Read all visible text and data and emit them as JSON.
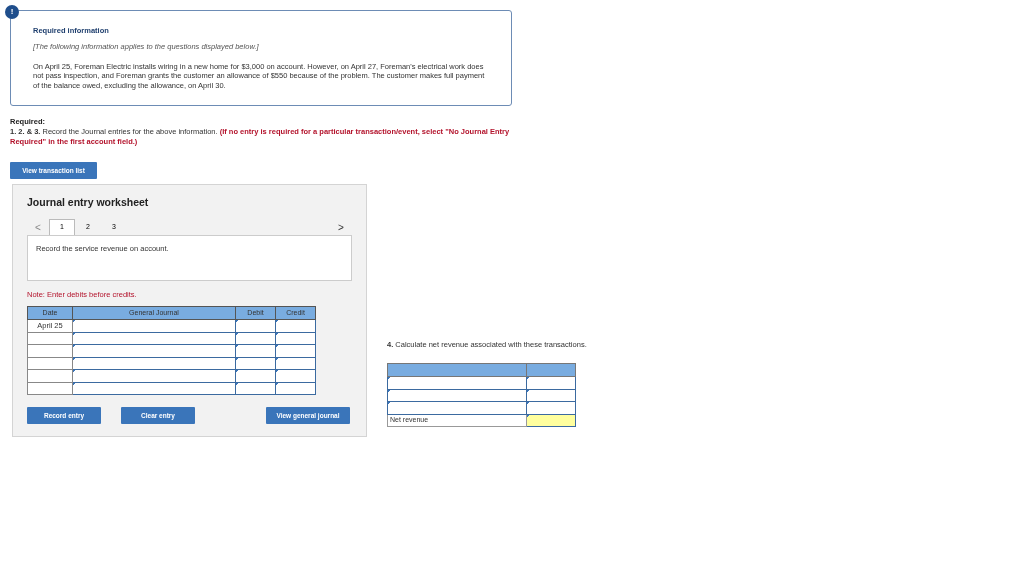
{
  "info": {
    "badge": "!",
    "title": "Required information",
    "intro": "[The following information applies to the questions displayed below.]",
    "body": "On April 25, Foreman Electric installs wiring in a new home for $3,000 on account. However, on April 27, Foreman's electrical work does not pass inspection, and Foreman grants the customer an allowance of $550 because of the problem. The customer makes full payment of the balance owed, excluding the allowance, on April 30."
  },
  "required": {
    "label": "Required:",
    "instruction": "**1. 2. & 3.** Record the Journal entries for the above information.",
    "note": "(If no entry is required for a particular transaction/event, select \"No Journal Entry Required\" in the first account field.)"
  },
  "transaction_button": "View transaction list",
  "worksheet": {
    "title": "Journal entry worksheet",
    "prev": "<",
    "next": ">",
    "tabs": [
      {
        "label": "1",
        "selected": true
      },
      {
        "label": "2",
        "selected": false
      },
      {
        "label": "3",
        "selected": false
      }
    ],
    "description": "Record the service revenue on account.",
    "note": "Note: Enter debits before credits.",
    "columns": [
      "Date",
      "General Journal",
      "Debit",
      "Credit"
    ],
    "rows": [
      {
        "date": "April 25"
      },
      {},
      {},
      {},
      {},
      {}
    ],
    "buttons": [
      "Record entry",
      "Clear entry",
      "View general journal"
    ]
  },
  "net_revenue": {
    "prompt": "**4.** Calculate net revenue associated with these transactions.",
    "rows": [
      {},
      {},
      {}
    ],
    "total_label": "Net revenue"
  }
}
